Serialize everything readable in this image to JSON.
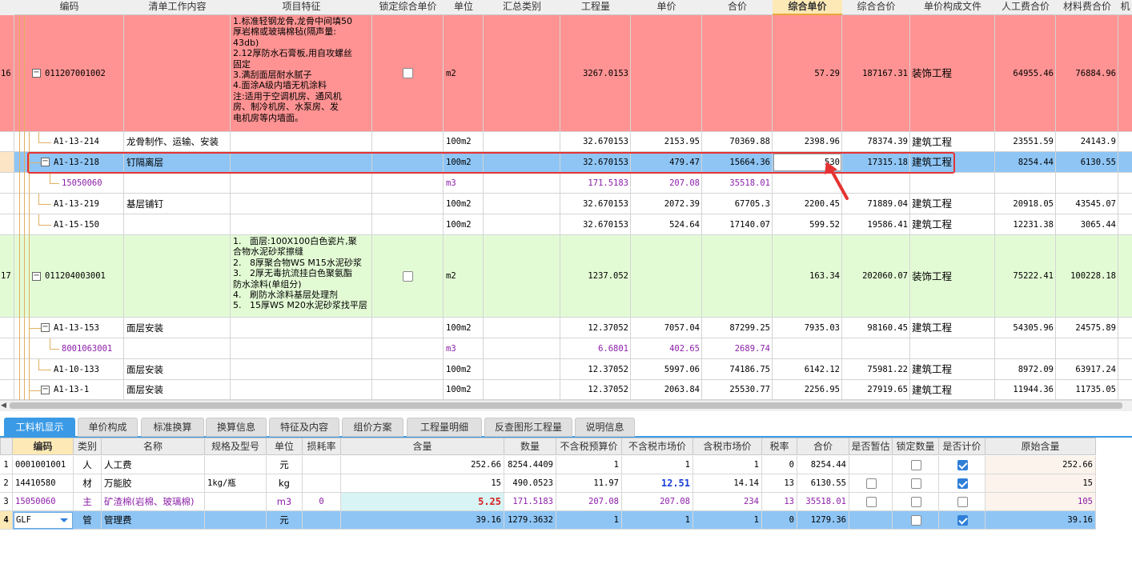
{
  "top_headers": [
    "编码",
    "清单工作内容",
    "项目特征",
    "锁定综合单价",
    "单位",
    "汇总类别",
    "工程量",
    "单价",
    "合价",
    "综合单价",
    "综合合价",
    "单价构成文件",
    "人工费合价",
    "材料费合价",
    "机"
  ],
  "rows": [
    {
      "num": "16",
      "code": "011207001002",
      "work": "",
      "feature": "1.标准轻钢龙骨,龙骨中间填50\n厚岩棉或玻璃棉毡(隔声量:\n43db)\n2.12厚防水石膏板,用自攻螺丝\n固定\n3.满刮面层耐水腻子\n4.面涂A级内墙无机涂料\n注:适用于空调机房、通风机\n房、制冷机房、水泵房、发\n电机房等内墙面。",
      "unit": "m2",
      "qty": "3267.0153",
      "price": "",
      "total": "",
      "comp_price": "57.29",
      "comp_total": "187167.31",
      "file": "装饰工程",
      "labor": "64955.46",
      "material": "76884.96"
    },
    {
      "num": "",
      "code": "A1-13-214",
      "work": "龙骨制作、运输、安装",
      "feature": "",
      "unit": "100m2",
      "qty": "32.670153",
      "price": "2153.95",
      "total": "70369.88",
      "comp_price": "2398.96",
      "comp_total": "78374.39",
      "file": "建筑工程",
      "labor": "23551.59",
      "material": "24143.9"
    },
    {
      "num": "",
      "code": "A1-13-218",
      "work": "钉隔离层",
      "feature": "",
      "unit": "100m2",
      "qty": "32.670153",
      "price": "479.47",
      "total": "15664.36",
      "comp_price": "530",
      "comp_total": "17315.18",
      "file": "建筑工程",
      "labor": "8254.44",
      "material": "6130.55"
    },
    {
      "num": "",
      "code": "15050060",
      "work": "",
      "feature": "",
      "unit": "m3",
      "qty": "171.5183",
      "price": "207.08",
      "total": "35518.01",
      "comp_price": "",
      "comp_total": "",
      "file": "",
      "labor": "",
      "material": ""
    },
    {
      "num": "",
      "code": "A1-13-219",
      "work": "基层铺钉",
      "feature": "",
      "unit": "100m2",
      "qty": "32.670153",
      "price": "2072.39",
      "total": "67705.3",
      "comp_price": "2200.45",
      "comp_total": "71889.04",
      "file": "建筑工程",
      "labor": "20918.05",
      "material": "43545.07"
    },
    {
      "num": "",
      "code": "A1-15-150",
      "work": "",
      "feature": "",
      "unit": "100m2",
      "qty": "32.670153",
      "price": "524.64",
      "total": "17140.07",
      "comp_price": "599.52",
      "comp_total": "19586.41",
      "file": "建筑工程",
      "labor": "12231.38",
      "material": "3065.44"
    },
    {
      "num": "17",
      "code": "011204003001",
      "work": "",
      "feature": "1.   面层:100X100白色瓷片,聚\n合物水泥砂浆擦缝\n2.   8厚聚合物WS M15水泥砂浆\n3.   2厚无毒抗流挂白色聚氨酯\n防水涂料(单组分)\n4.   刷防水涂料基层处理剂\n5.   15厚WS M20水泥砂浆找平层",
      "unit": "m2",
      "qty": "1237.052",
      "price": "",
      "total": "",
      "comp_price": "163.34",
      "comp_total": "202060.07",
      "file": "装饰工程",
      "labor": "75222.41",
      "material": "100228.18"
    },
    {
      "num": "",
      "code": "A1-13-153",
      "work": "面层安装",
      "feature": "",
      "unit": "100m2",
      "qty": "12.37052",
      "price": "7057.04",
      "total": "87299.25",
      "comp_price": "7935.03",
      "comp_total": "98160.45",
      "file": "建筑工程",
      "labor": "54305.96",
      "material": "24575.89"
    },
    {
      "num": "",
      "code": "8001063001",
      "work": "",
      "feature": "",
      "unit": "m3",
      "qty": "6.6801",
      "price": "402.65",
      "total": "2689.74",
      "comp_price": "",
      "comp_total": "",
      "file": "",
      "labor": "",
      "material": ""
    },
    {
      "num": "",
      "code": "A1-10-133",
      "work": "面层安装",
      "feature": "",
      "unit": "100m2",
      "qty": "12.37052",
      "price": "5997.06",
      "total": "74186.75",
      "comp_price": "6142.12",
      "comp_total": "75981.22",
      "file": "建筑工程",
      "labor": "8972.09",
      "material": "63917.24"
    },
    {
      "num": "",
      "code": "A1-13-1",
      "work": "面层安装",
      "feature": "",
      "unit": "100m2",
      "qty": "12.37052",
      "price": "2063.84",
      "total": "25530.77",
      "comp_price": "2256.95",
      "comp_total": "27919.65",
      "file": "建筑工程",
      "labor": "11944.36",
      "material": "11735.05"
    }
  ],
  "tabs": [
    "工料机显示",
    "单价构成",
    "标准换算",
    "换算信息",
    "特征及内容",
    "组价方案",
    "工程量明细",
    "反查图形工程量",
    "说明信息"
  ],
  "bottom_headers": [
    "编码",
    "类别",
    "名称",
    "规格及型号",
    "单位",
    "损耗率",
    "含量",
    "数量",
    "不含税预算价",
    "不含税市场价",
    "含税市场价",
    "税率",
    "合价",
    "是否暂估",
    "锁定数量",
    "是否计价",
    "原始含量"
  ],
  "bottom_rows": [
    {
      "num": "1",
      "code": "0001001001",
      "type": "人",
      "name": "人工费",
      "spec": "",
      "unit": "元",
      "loss": "",
      "content": "252.66",
      "qty": "8254.4409",
      "budget": "1",
      "market": "1",
      "market_tax": "1",
      "tax": "0",
      "total": "8254.44",
      "orig": "252.66"
    },
    {
      "num": "2",
      "code": "14410580",
      "type": "材",
      "name": "万能胶",
      "spec": "1kg/瓶",
      "unit": "kg",
      "loss": "",
      "content": "15",
      "qty": "490.0523",
      "budget": "11.97",
      "market": "12.51",
      "market_tax": "14.14",
      "tax": "13",
      "total": "6130.55",
      "orig": "15"
    },
    {
      "num": "3",
      "code": "15050060",
      "type": "主",
      "name": "矿渣棉(岩棉、玻璃棉)",
      "spec": "",
      "unit": "m3",
      "loss": "0",
      "content": "5.25",
      "qty": "171.5183",
      "budget": "207.08",
      "market": "207.08",
      "market_tax": "234",
      "tax": "13",
      "total": "35518.01",
      "orig": "105"
    },
    {
      "num": "4",
      "code": "GLF",
      "type": "管",
      "name": "管理费",
      "spec": "",
      "unit": "元",
      "loss": "",
      "content": "39.16",
      "qty": "1279.3632",
      "budget": "1",
      "market": "1",
      "market_tax": "1",
      "tax": "0",
      "total": "1279.36",
      "orig": "39.16"
    }
  ],
  "colors": {
    "row16_bg": "#ff9393",
    "row17_bg": "#e3fbd5",
    "selected_bg": "#8ec5f5",
    "highlight_red": "#e53333",
    "tab_active": "#3a9ae5"
  }
}
